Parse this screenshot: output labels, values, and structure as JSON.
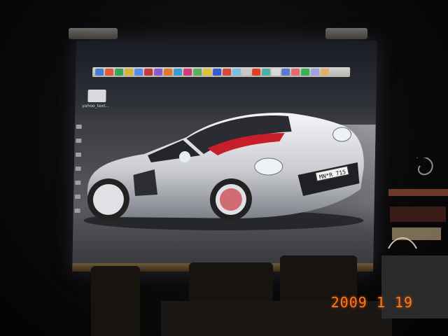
{
  "screen": {
    "desktop_icon_label": "yahoo_text...",
    "license_plate": "MN*R 715"
  },
  "colors": {
    "timestamp": "#ff7a1a",
    "car_body": "#d7d9dd",
    "car_interior": "#c81e2a"
  },
  "timestamp": {
    "text": "2009   1  19"
  }
}
